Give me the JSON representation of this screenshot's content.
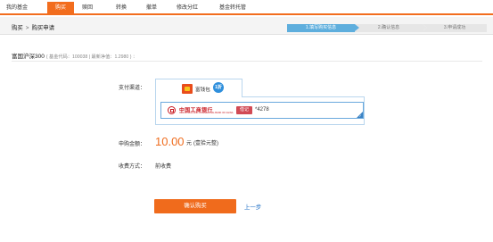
{
  "nav": {
    "tabs": [
      {
        "label": "我的基金",
        "active": false
      },
      {
        "label": "购买",
        "active": true
      },
      {
        "label": "赎回",
        "active": false
      },
      {
        "label": "转换",
        "active": false
      },
      {
        "label": "撤单",
        "active": false
      },
      {
        "label": "修改分红",
        "active": false
      },
      {
        "label": "基金转托管",
        "active": false
      }
    ],
    "accent_color": "#f26d1e"
  },
  "breadcrumb": {
    "parent": "购买",
    "separator": ">",
    "current": "购买申请"
  },
  "steps": [
    {
      "label": "1.填写购买信息",
      "state": "current"
    },
    {
      "label": "2.确认信息",
      "state": "pending"
    },
    {
      "label": "3.申请成功",
      "state": "pending"
    }
  ],
  "fund": {
    "name": "富国沪深300",
    "meta": "( 基金代码：100038 | 最新净值：1.2980 ) ："
  },
  "form": {
    "payment_channel_label": "支付渠道：",
    "wallet_name": "富钱包",
    "wallet_icon": "wallet-icon",
    "wallet_badge": "1折",
    "bank": {
      "name": "中国工商银行",
      "name_en": "INDUSTRIAL AND COMMERCIAL BANK OF CHINA",
      "card_type": "借记",
      "card_number": "*4278",
      "logo_icon": "icbc-logo-icon"
    },
    "amount_label": "申购金额：",
    "amount_value": "10.00",
    "amount_unit": "元",
    "amount_words": "(壹拾元整)",
    "fee_label": "收费方式：",
    "fee_mode": "前收费"
  },
  "actions": {
    "confirm_label": "确认购买",
    "back_label": "上一步"
  }
}
